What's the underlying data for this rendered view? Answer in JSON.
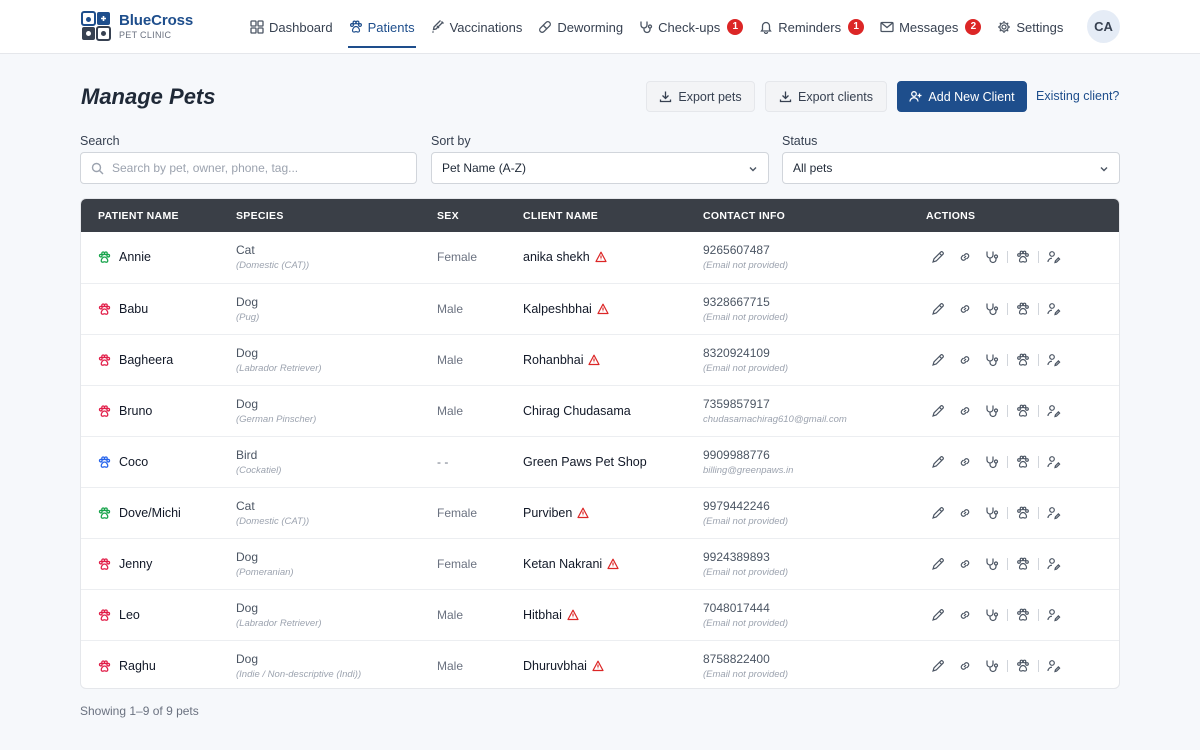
{
  "brand": {
    "name": "BlueCross",
    "subtitle": "PET CLINIC"
  },
  "nav": {
    "items": [
      {
        "label": "Dashboard",
        "icon": "grid-icon"
      },
      {
        "label": "Patients",
        "icon": "paw-icon",
        "active": true
      },
      {
        "label": "Vaccinations",
        "icon": "syringe-icon"
      },
      {
        "label": "Deworming",
        "icon": "pill-icon"
      },
      {
        "label": "Check-ups",
        "icon": "stethoscope-icon",
        "badge": "1"
      },
      {
        "label": "Reminders",
        "icon": "bell-icon",
        "badge": "1"
      },
      {
        "label": "Messages",
        "icon": "mail-icon",
        "badge": "2"
      },
      {
        "label": "Settings",
        "icon": "gear-icon"
      }
    ],
    "avatar": "CA"
  },
  "header": {
    "title": "Manage Pets",
    "export_pets": "Export pets",
    "export_clients": "Export clients",
    "add_client": "Add New Client",
    "existing_client": "Existing client?"
  },
  "filters": {
    "search_label": "Search",
    "search_placeholder": "Search by pet, owner, phone, tag...",
    "sort_label": "Sort by",
    "sort_value": "Pet Name (A-Z)",
    "status_label": "Status",
    "status_value": "All pets"
  },
  "table": {
    "columns": [
      "PATIENT NAME",
      "SPECIES",
      "SEX",
      "CLIENT NAME",
      "CONTACT INFO",
      "ACTIONS"
    ],
    "rows": [
      {
        "name": "Annie",
        "paw_color": "#16a34a",
        "species": "Cat",
        "breed": "(Domestic (CAT))",
        "sex": "Female",
        "client": "anika shekh",
        "warning": true,
        "phone": "9265607487",
        "email": "(Email not provided)"
      },
      {
        "name": "Babu",
        "paw_color": "#e11d48",
        "species": "Dog",
        "breed": "(Pug)",
        "sex": "Male",
        "client": "Kalpeshbhai",
        "warning": true,
        "phone": "9328667715",
        "email": "(Email not provided)"
      },
      {
        "name": "Bagheera",
        "paw_color": "#e11d48",
        "species": "Dog",
        "breed": "(Labrador Retriever)",
        "sex": "Male",
        "client": "Rohanbhai",
        "warning": true,
        "phone": "8320924109",
        "email": "(Email not provided)"
      },
      {
        "name": "Bruno",
        "paw_color": "#e11d48",
        "species": "Dog",
        "breed": "(German Pinscher)",
        "sex": "Male",
        "client": "Chirag Chudasama",
        "warning": false,
        "phone": "7359857917",
        "email": "chudasamachirag610@gmail.com"
      },
      {
        "name": "Coco",
        "paw_color": "#2563eb",
        "species": "Bird",
        "breed": "(Cockatiel)",
        "sex": "- -",
        "client": "Green Paws Pet Shop",
        "warning": false,
        "phone": "9909988776",
        "email": "billing@greenpaws.in"
      },
      {
        "name": "Dove/Michi",
        "paw_color": "#16a34a",
        "species": "Cat",
        "breed": "(Domestic (CAT))",
        "sex": "Female",
        "client": "Purviben",
        "warning": true,
        "phone": "9979442246",
        "email": "(Email not provided)"
      },
      {
        "name": "Jenny",
        "paw_color": "#e11d48",
        "species": "Dog",
        "breed": "(Pomeranian)",
        "sex": "Female",
        "client": "Ketan Nakrani",
        "warning": true,
        "phone": "9924389893",
        "email": "(Email not provided)"
      },
      {
        "name": "Leo",
        "paw_color": "#e11d48",
        "species": "Dog",
        "breed": "(Labrador Retriever)",
        "sex": "Male",
        "client": "Hitbhai",
        "warning": true,
        "phone": "7048017444",
        "email": "(Email not provided)"
      },
      {
        "name": "Raghu",
        "paw_color": "#e11d48",
        "species": "Dog",
        "breed": "(Indie / Non-descriptive (Indi))",
        "sex": "Male",
        "client": "Dhuruvbhai",
        "warning": true,
        "phone": "8758822400",
        "email": "(Email not provided)"
      }
    ],
    "actions": [
      "edit-icon",
      "link-icon",
      "stethoscope-icon",
      "paw-icon",
      "user-edit-icon"
    ]
  },
  "footer": {
    "count": "Showing 1–9 of 9 pets"
  },
  "colors": {
    "primary": "#1e4e8c",
    "badge": "#dc2626",
    "header_bg": "#3a3f47"
  }
}
